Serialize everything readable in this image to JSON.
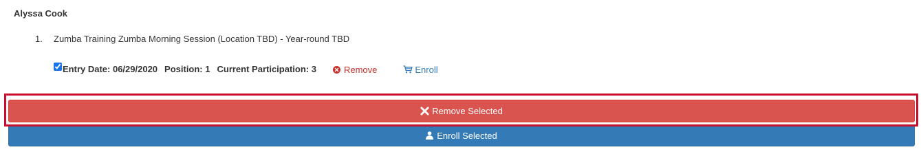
{
  "person": {
    "name": "Alyssa Cook"
  },
  "session": {
    "number": "1.",
    "title": "Zumba Training Zumba Morning Session (Location TBD) - Year-round TBD"
  },
  "entry": {
    "checked": true,
    "entry_date": "Entry Date: 06/29/2020",
    "position": "Position: 1",
    "participation": "Current Participation: 3",
    "remove_label": "Remove",
    "enroll_label": "Enroll"
  },
  "actions": {
    "remove_selected_label": "Remove Selected",
    "enroll_selected_label": "Enroll Selected"
  },
  "colors": {
    "danger": "#d9534f",
    "primary": "#337ab7",
    "highlight": "#c8102e",
    "remove_link": "#c9302c",
    "enroll_link": "#337ab7"
  },
  "icons": {
    "remove_link_icon": "circle-x-icon",
    "enroll_link_icon": "cart-icon",
    "remove_selected_icon": "x-icon",
    "enroll_selected_icon": "user-icon"
  }
}
